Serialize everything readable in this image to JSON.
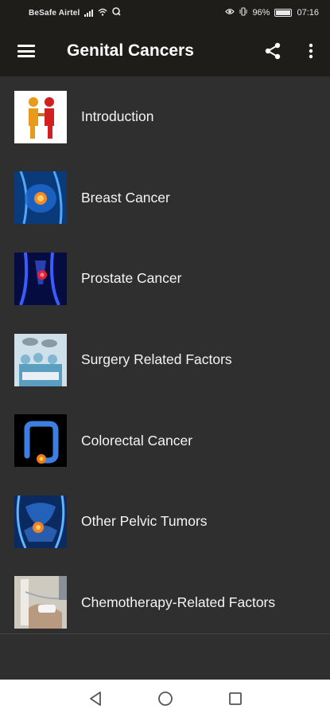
{
  "status": {
    "carrier": "BeSafe Airtel",
    "battery": "96%",
    "time": "07:16",
    "battery_level": 0.96
  },
  "app_bar": {
    "title": "Genital Cancers",
    "icons": [
      "menu-icon",
      "share-icon",
      "more-vert-icon"
    ]
  },
  "items": [
    {
      "label": "Introduction",
      "thumb": "handshake-figures"
    },
    {
      "label": "Breast Cancer",
      "thumb": "breast-xray"
    },
    {
      "label": "Prostate Cancer",
      "thumb": "prostate-xray"
    },
    {
      "label": "Surgery Related Factors",
      "thumb": "surgery-team"
    },
    {
      "label": "Colorectal Cancer",
      "thumb": "colon-xray"
    },
    {
      "label": "Other Pelvic Tumors",
      "thumb": "pelvis-xray"
    },
    {
      "label": "Chemotherapy-Related Factors",
      "thumb": "iv-drip"
    }
  ],
  "nav": {
    "icons": [
      "back-icon",
      "home-icon",
      "recents-icon"
    ]
  },
  "colors": {
    "app_bar": "#1f1d1a",
    "background": "#2f2f2f",
    "nav_bar": "#ffffff"
  }
}
